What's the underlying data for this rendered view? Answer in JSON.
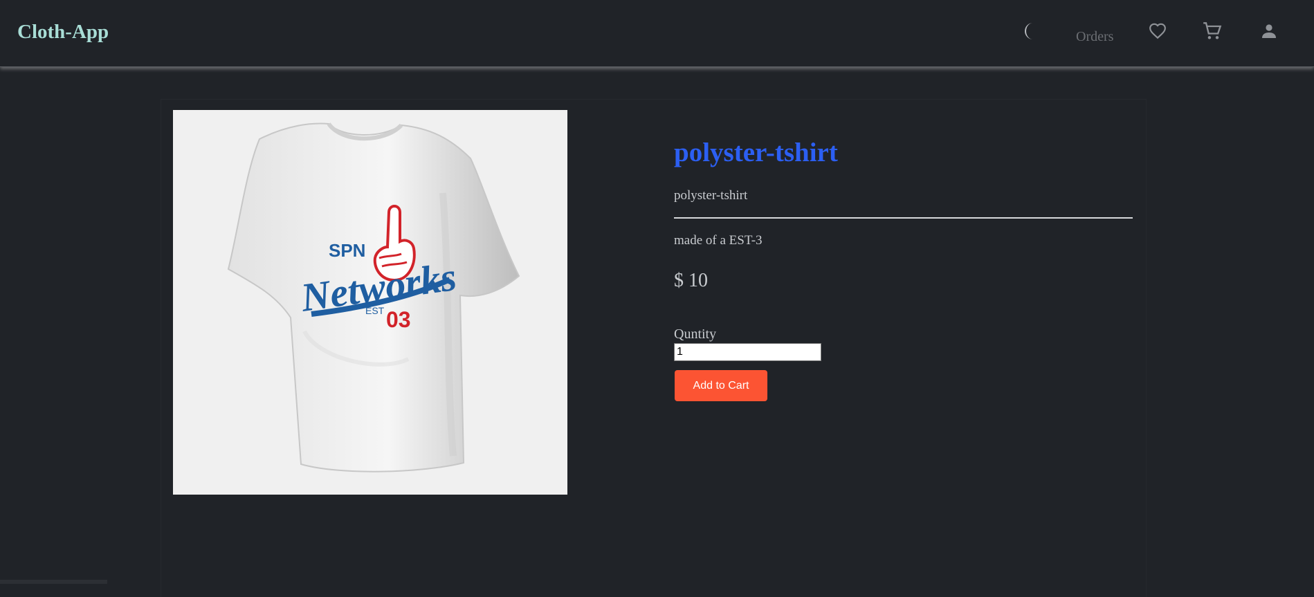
{
  "navbar": {
    "brand": "Cloth-App",
    "orders_label": "Orders",
    "icons": [
      "moon-icon",
      "heart-icon",
      "cart-icon",
      "user-icon"
    ]
  },
  "product": {
    "title": "polyster-tshirt",
    "subtitle": "polyster-tshirt",
    "description": "made of a EST-3",
    "price": "$ 10",
    "quantity_label": "Quntity",
    "quantity_value": "1",
    "add_to_cart_label": "Add to Cart",
    "image_print": {
      "line1": "SPN",
      "line2": "Networks",
      "est": "EST",
      "number": "03"
    }
  },
  "colors": {
    "background": "#202328",
    "brand": "#a8ddd6",
    "title": "#2c5ff2",
    "button": "#fc5433"
  }
}
